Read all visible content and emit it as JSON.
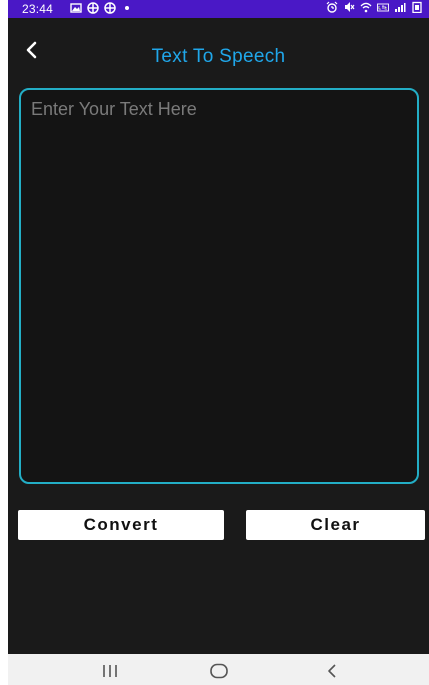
{
  "status_bar": {
    "time": "23:44",
    "left_icons": [
      "gallery-icon",
      "vpn-icon",
      "vpn-icon",
      "dot-icon"
    ],
    "right_icons": [
      "alarm-icon",
      "mute-icon",
      "wifi-icon",
      "volte-lte-icon",
      "signal-icon",
      "battery-icon"
    ],
    "background_color": "#4a18c6"
  },
  "appbar": {
    "title": "Text To Speech",
    "title_color": "#20a7ea",
    "back_icon": "chevron-left-icon"
  },
  "editor": {
    "placeholder": "Enter Your Text Here",
    "value": "",
    "border_color": "#23aec6"
  },
  "actions": {
    "convert_label": "Convert",
    "clear_label": "Clear"
  },
  "nav_bar": {
    "items": [
      "recent-apps-icon",
      "home-icon",
      "back-icon"
    ]
  }
}
